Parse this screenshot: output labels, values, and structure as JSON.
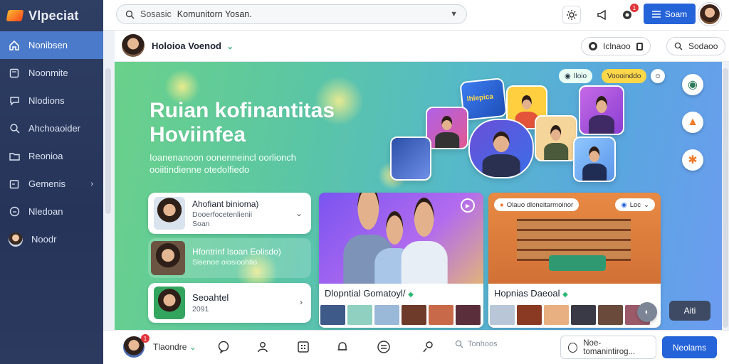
{
  "app": {
    "name": "Vlpeciat"
  },
  "sidebar": {
    "items": [
      {
        "label": "Nonibsen",
        "icon": "home-icon",
        "active": true
      },
      {
        "label": "Noonmite",
        "icon": "document-icon"
      },
      {
        "label": "Nlodions",
        "icon": "chat-icon"
      },
      {
        "label": "Ahchoaoider",
        "icon": "search-icon"
      },
      {
        "label": "Reonioa",
        "icon": "folder-icon"
      },
      {
        "label": "Gemenis",
        "icon": "calendar-icon",
        "has_chevron": true
      },
      {
        "label": "Nledoan",
        "icon": "clock-icon"
      },
      {
        "label": "Noodr",
        "icon": "avatar"
      }
    ]
  },
  "topbar": {
    "search": {
      "prefix": "Sosasic",
      "value": "Komunitorn Yosan."
    },
    "notification_count": "1",
    "button_label": "Soam"
  },
  "subbar": {
    "name": "Holoioa Voenod",
    "pill1": "Iclnaoo",
    "pill2": "Sodaoo"
  },
  "hero": {
    "title_line1": "Ruian kofinantitas",
    "title_line2": "Hoviinfea",
    "subtitle_line1": "Ioanenanoon oonenneincl oorlionch",
    "subtitle_line2": "ooiitindienne otedolfiedo",
    "chip1": "Iloio",
    "chip2": "Voooinddo",
    "tile_label": "Ihlepica"
  },
  "cards": [
    {
      "title": "Ahofiant binioma)",
      "sub1": "Dooerfocetenlienii",
      "sub2": "Soan"
    },
    {
      "title": "Hfontrinf Isoan Eolisdo)",
      "sub1": "Sisenoe oiosioohtio"
    },
    {
      "title": "Seoahtel",
      "sub1": "2091"
    }
  ],
  "media": [
    {
      "caption": "Dlopntial Gomatoyl/"
    },
    {
      "caption": "Hopnias Daeoal",
      "header_left": "Olauo dloneitarmoinor",
      "header_right": "Loc"
    }
  ],
  "float_button": "Aiti",
  "bottombar": {
    "name": "Tlaondre",
    "search_placeholder": "Tonhoos",
    "input_value": "Noe-tomanintirog...",
    "button_label": "Neolams",
    "notification_count": "1"
  },
  "colors": {
    "sidebar_bg": "#2f3e63",
    "sidebar_active": "#4a7ac9",
    "accent_blue": "#2563d9",
    "hero_green": "#6ad18a",
    "hero_blue": "#5aa6e0",
    "verified_green": "#2bb673",
    "badge_red": "#e0353a"
  }
}
